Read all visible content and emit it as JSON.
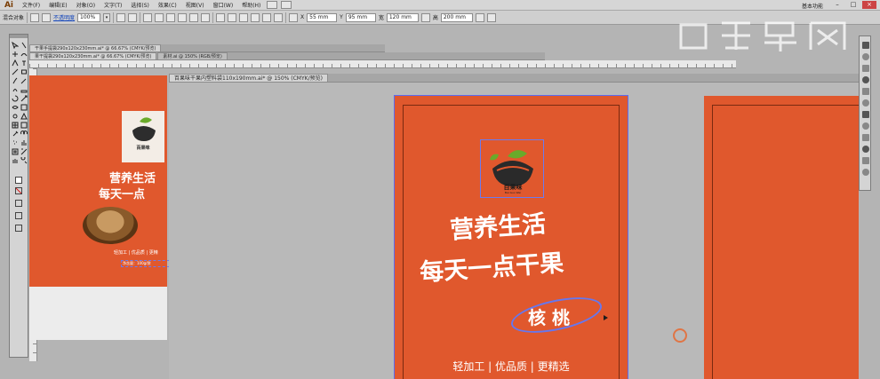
{
  "app": {
    "logo": "Ai",
    "workspace": "基本功能"
  },
  "menu": [
    "文件(F)",
    "编辑(E)",
    "对象(O)",
    "文字(T)",
    "选择(S)",
    "效果(C)",
    "视图(V)",
    "窗口(W)",
    "帮助(H)"
  ],
  "control_bar": {
    "selection_label": "混合对象",
    "opacity_link": "不透明度",
    "opacity_value": "100%",
    "x_label": "X",
    "x_value": "55 mm",
    "y_label": "Y",
    "y_value": "95 mm",
    "w_label": "宽",
    "w_value": "120 mm",
    "h_label": "高",
    "h_value": "200 mm"
  },
  "tabs_back": [
    {
      "label": "干果手提袋290x120x230mm.ai* @ 66.67% (CMYK/预览)"
    }
  ],
  "tabs_mid": [
    {
      "label": "果干提袋290x120x230mm.ai* @ 66.67% (CMYK/预览)"
    },
    {
      "label": "素材.ai @ 150% (RGB/预览)"
    }
  ],
  "tabs_front": [
    {
      "label": "百果味干果内塑料袋110x190mm.ai* @ 150% (CMYK/预览)"
    }
  ],
  "artwork": {
    "brand_name": "百果味",
    "brand_sub": "Bai Guo Wei",
    "headline_1": "营养生活",
    "headline_2": "每天一点干果",
    "product": "核 桃",
    "tagline": "轻加工 | 优品质 | 更精选",
    "left_headline_1": "营养生活",
    "left_headline_2": "每天一点",
    "left_tagline": "轻加工 | 优品质 | 更精",
    "left_weight": "净含量：100g/袋"
  },
  "colors": {
    "artboard": "#e0582d",
    "accent_select": "#5b6cf2",
    "ui_gray": "#b4b4b4"
  }
}
